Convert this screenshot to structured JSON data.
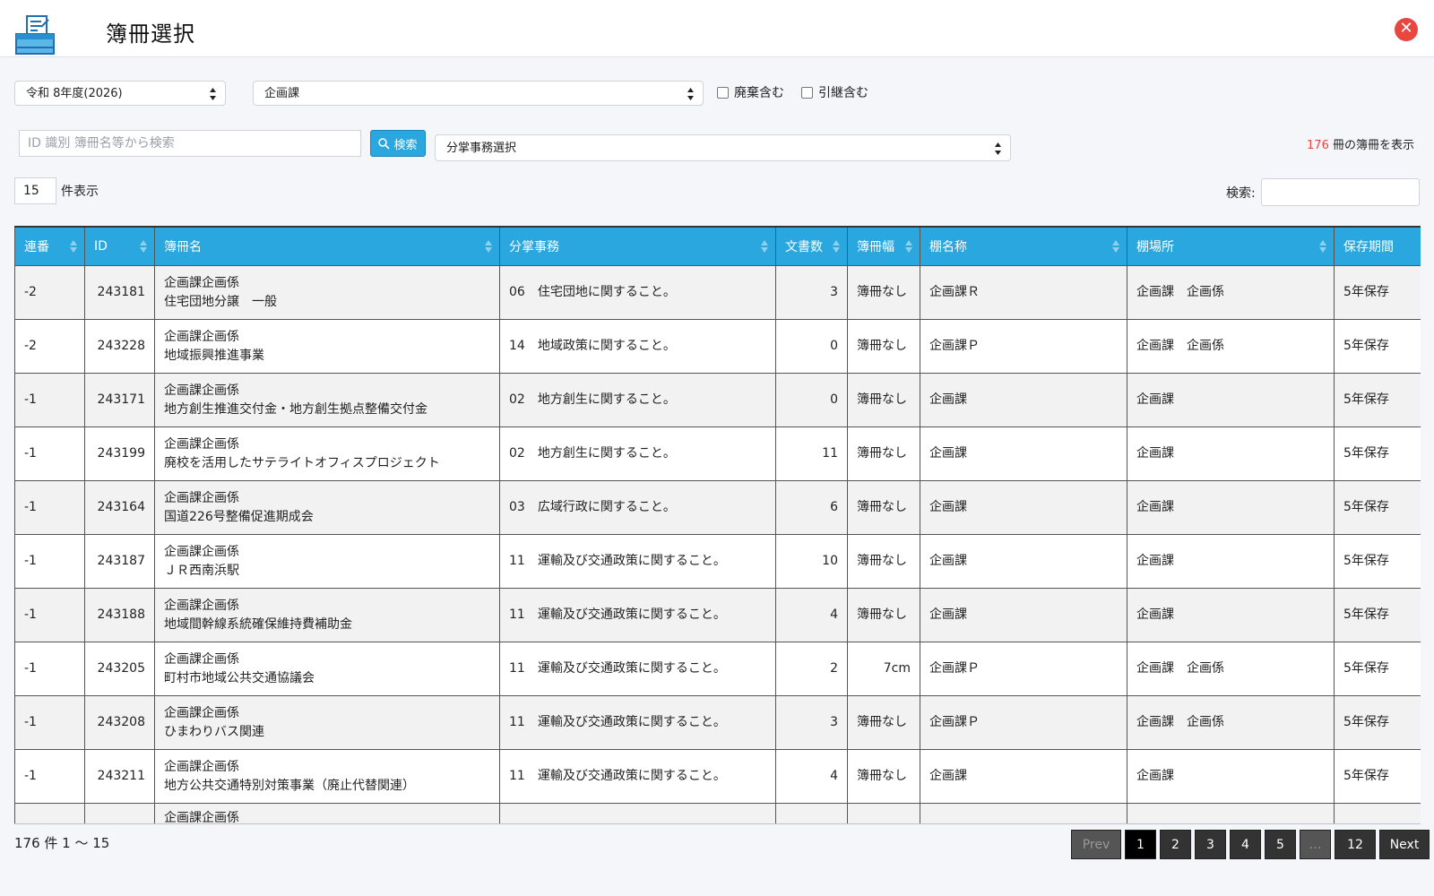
{
  "header": {
    "title": "簿冊選択",
    "close_symbol": "✕"
  },
  "filters": {
    "year_select": "令和 8年度(2026)",
    "dept_select": "企画課",
    "include_disposed_label": "廃棄含む",
    "include_transferred_label": "引継含む",
    "search_placeholder": "ID 識別 簿冊名等から検索",
    "search_button": "検索",
    "division_select": "分掌事務選択",
    "count_number": "176",
    "count_suffix": " 冊の簿冊を表示",
    "page_length": "15",
    "page_length_label": "件表示",
    "table_filter_label": "検索:",
    "table_filter_value": ""
  },
  "table": {
    "headers": [
      "連番",
      "ID",
      "簿冊名",
      "分掌事務",
      "文書数",
      "簿冊幅",
      "棚名称",
      "棚場所",
      "保存期間"
    ],
    "rows": [
      {
        "seq": "-2",
        "id": "243181",
        "name1": "企画課企画係",
        "name2": "住宅団地分譲　一般",
        "division": "06　住宅団地に関すること。",
        "docs": "3",
        "width": "簿冊なし",
        "shelf": "企画課Ｒ",
        "location": "企画課　企画係",
        "retention": "5年保存"
      },
      {
        "seq": "-2",
        "id": "243228",
        "name1": "企画課企画係",
        "name2": "地域振興推進事業",
        "division": "14　地域政策に関すること。",
        "docs": "0",
        "width": "簿冊なし",
        "shelf": "企画課Ｐ",
        "location": "企画課　企画係",
        "retention": "5年保存"
      },
      {
        "seq": "-1",
        "id": "243171",
        "name1": "企画課企画係",
        "name2": "地方創生推進交付金・地方創生拠点整備交付金",
        "division": "02　地方創生に関すること。",
        "docs": "0",
        "width": "簿冊なし",
        "shelf": "企画課",
        "location": "企画課",
        "retention": "5年保存"
      },
      {
        "seq": "-1",
        "id": "243199",
        "name1": "企画課企画係",
        "name2": "廃校を活用したサテライトオフィスプロジェクト",
        "division": "02　地方創生に関すること。",
        "docs": "11",
        "width": "簿冊なし",
        "shelf": "企画課",
        "location": "企画課",
        "retention": "5年保存"
      },
      {
        "seq": "-1",
        "id": "243164",
        "name1": "企画課企画係",
        "name2": "国道226号整備促進期成会",
        "division": "03　広域行政に関すること。",
        "docs": "6",
        "width": "簿冊なし",
        "shelf": "企画課",
        "location": "企画課",
        "retention": "5年保存"
      },
      {
        "seq": "-1",
        "id": "243187",
        "name1": "企画課企画係",
        "name2": "ＪＲ西南浜駅",
        "division": "11　運輸及び交通政策に関すること。",
        "docs": "10",
        "width": "簿冊なし",
        "shelf": "企画課",
        "location": "企画課",
        "retention": "5年保存"
      },
      {
        "seq": "-1",
        "id": "243188",
        "name1": "企画課企画係",
        "name2": "地域間幹線系統確保維持費補助金",
        "division": "11　運輸及び交通政策に関すること。",
        "docs": "4",
        "width": "簿冊なし",
        "shelf": "企画課",
        "location": "企画課",
        "retention": "5年保存"
      },
      {
        "seq": "-1",
        "id": "243205",
        "name1": "企画課企画係",
        "name2": "町村市地域公共交通協議会",
        "division": "11　運輸及び交通政策に関すること。",
        "docs": "2",
        "width": "7cm",
        "shelf": "企画課Ｐ",
        "location": "企画課　企画係",
        "retention": "5年保存"
      },
      {
        "seq": "-1",
        "id": "243208",
        "name1": "企画課企画係",
        "name2": "ひまわりバス関連",
        "division": "11　運輸及び交通政策に関すること。",
        "docs": "3",
        "width": "簿冊なし",
        "shelf": "企画課Ｐ",
        "location": "企画課　企画係",
        "retention": "5年保存"
      },
      {
        "seq": "-1",
        "id": "243211",
        "name1": "企画課企画係",
        "name2": "地方公共交通特別対策事業（廃止代替関連）",
        "division": "11　運輸及び交通政策に関すること。",
        "docs": "4",
        "width": "簿冊なし",
        "shelf": "企画課",
        "location": "企画課",
        "retention": "5年保存"
      },
      {
        "seq": "",
        "id": "",
        "name1": "企画課企画係",
        "name2": "",
        "division": "",
        "docs": "",
        "width": "",
        "shelf": "",
        "location": "",
        "retention": ""
      }
    ]
  },
  "footer": {
    "info": "176 件 1 〜 15",
    "pagination": [
      "Prev",
      "1",
      "2",
      "3",
      "4",
      "5",
      "…",
      "12",
      "Next"
    ],
    "active_page": "1"
  }
}
